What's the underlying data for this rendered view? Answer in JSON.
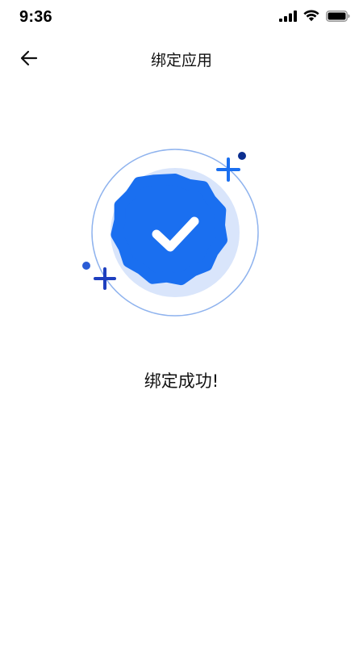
{
  "status_bar": {
    "time": "9:36",
    "icons": [
      "cellular-signal-icon",
      "wifi-icon",
      "battery-icon"
    ]
  },
  "nav": {
    "back_icon": "arrow-left-icon",
    "title": "绑定应用"
  },
  "result": {
    "icon": "verified-badge-check-icon",
    "message": "绑定成功!"
  },
  "colors": {
    "accent": "#1a6ff0",
    "halo": "#d9e5fb",
    "ring": "#8fb3ee",
    "sparkle_dark": "#0b2e8f",
    "text": "#111111",
    "background": "#ffffff"
  }
}
